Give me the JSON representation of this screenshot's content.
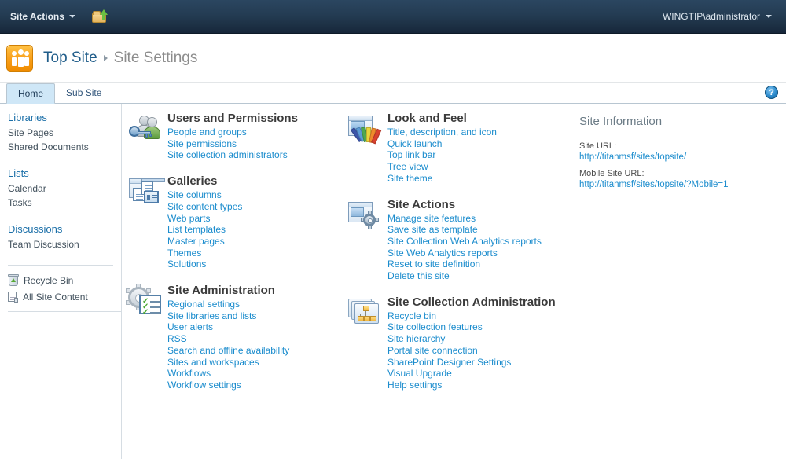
{
  "topbar": {
    "site_actions_label": "Site Actions",
    "navigate_up_icon": "folder-up-arrow-icon",
    "user_label": "WINGTIP\\administrator"
  },
  "title_area": {
    "logo_icon": "site-people-logo-icon",
    "breadcrumb_site": "Top Site",
    "breadcrumb_separator": "▸",
    "breadcrumb_current": "Site Settings"
  },
  "tabs": [
    {
      "label": "Home",
      "active": true
    },
    {
      "label": "Sub Site",
      "active": false
    }
  ],
  "help": {
    "label": "?"
  },
  "sidebar": {
    "groups": [
      {
        "heading": "Libraries",
        "items": [
          "Site Pages",
          "Shared Documents"
        ]
      },
      {
        "heading": "Lists",
        "items": [
          "Calendar",
          "Tasks"
        ]
      },
      {
        "heading": "Discussions",
        "items": [
          "Team Discussion"
        ]
      }
    ],
    "special": [
      {
        "label": "Recycle Bin",
        "icon": "recycle-bin-icon"
      },
      {
        "label": "All Site Content",
        "icon": "all-site-content-icon"
      }
    ]
  },
  "columns": {
    "col1": [
      {
        "title": "Users and Permissions",
        "icon": "users-permissions-icon",
        "links": [
          "People and groups",
          "Site permissions",
          "Site collection administrators"
        ]
      },
      {
        "title": "Galleries",
        "icon": "galleries-icon",
        "links": [
          "Site columns",
          "Site content types",
          "Web parts",
          "List templates",
          "Master pages",
          "Themes",
          "Solutions"
        ]
      },
      {
        "title": "Site Administration",
        "icon": "site-administration-icon",
        "links": [
          "Regional settings",
          "Site libraries and lists",
          "User alerts",
          "RSS",
          "Search and offline availability",
          "Sites and workspaces",
          "Workflows",
          "Workflow settings"
        ]
      }
    ],
    "col2": [
      {
        "title": "Look and Feel",
        "icon": "look-and-feel-icon",
        "links": [
          "Title, description, and icon",
          "Quick launch",
          "Top link bar",
          "Tree view",
          "Site theme"
        ]
      },
      {
        "title": "Site Actions",
        "icon": "site-actions-icon",
        "links": [
          "Manage site features",
          "Save site as template",
          "Site Collection Web Analytics reports",
          "Site Web Analytics reports",
          "Reset to site definition",
          "Delete this site"
        ]
      },
      {
        "title": "Site Collection Administration",
        "icon": "site-collection-administration-icon",
        "links": [
          "Recycle bin",
          "Site collection features",
          "Site hierarchy",
          "Portal site connection",
          "SharePoint Designer Settings",
          "Visual Upgrade",
          "Help settings"
        ]
      }
    ]
  },
  "site_information": {
    "title": "Site Information",
    "site_url_label": "Site URL:",
    "site_url": "http://titanmsf/sites/topsite/",
    "mobile_url_label": "Mobile Site URL:",
    "mobile_url": "http://titanmsf/sites/topsite/?Mobile=1"
  },
  "colors": {
    "header_bg": "#223b52",
    "link": "#1b8ccd",
    "nav_heading": "#1b6fa8",
    "tab_active_bg": "#cfe7f7",
    "logo_orange": "#f9a01b"
  }
}
